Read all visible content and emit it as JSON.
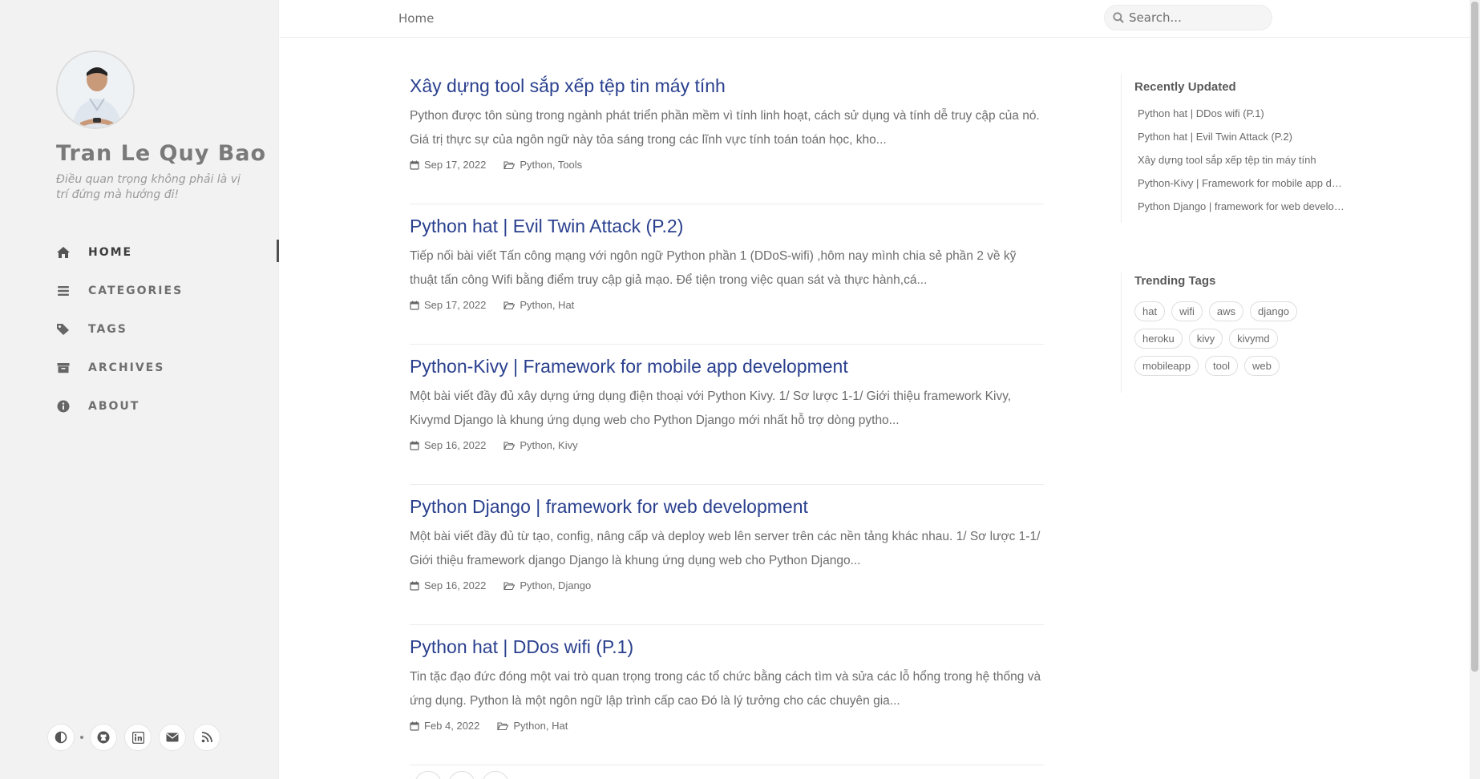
{
  "sidebar": {
    "site_title": "Tran Le Quy Bao",
    "site_subtitle": "Điều quan trọng không phải là vị trí đứng mà hướng đi!",
    "nav": [
      {
        "label": "HOME",
        "icon": "home-icon"
      },
      {
        "label": "CATEGORIES",
        "icon": "stream-icon"
      },
      {
        "label": "TAGS",
        "icon": "tag-icon"
      },
      {
        "label": "ARCHIVES",
        "icon": "archive-icon"
      },
      {
        "label": "ABOUT",
        "icon": "info-circle-icon"
      }
    ],
    "bottom_icons": [
      "theme-toggle-icon",
      "github-icon",
      "linkedin-icon",
      "email-icon",
      "rss-icon"
    ]
  },
  "topbar": {
    "breadcrumb": "Home",
    "search_placeholder": "Search..."
  },
  "posts": [
    {
      "title": "Xây dựng tool sắp xếp tệp tin máy tính",
      "excerpt": "Python được tôn sùng trong ngành phát triển phần mềm vì tính linh hoạt, cách sử dụng và tính dễ truy cập của nó. Giá trị thực sự của ngôn ngữ này tỏa sáng trong các lĩnh vực tính toán toán học, kho...",
      "date": "Sep 17, 2022",
      "categories": "Python, Tools"
    },
    {
      "title": "Python hat | Evil Twin Attack (P.2)",
      "excerpt": "Tiếp nối bài viết Tấn công mạng với ngôn ngữ Python phần 1 (DDoS-wifi) ,hôm nay mình chia sẻ phần 2 về kỹ thuật tấn công Wifi bằng điểm truy cập giả mạo. Để tiện trong việc quan sát và thực hành,cá...",
      "date": "Sep 17, 2022",
      "categories": "Python, Hat"
    },
    {
      "title": "Python-Kivy | Framework for mobile app development",
      "excerpt": "Một bài viết đầy đủ xây dựng ứng dụng điện thoại với Python Kivy. 1/ Sơ lược 1-1/ Giới thiệu framework Kivy, Kivymd Django là khung ứng dụng web cho Python Django mới nhất hỗ trợ dòng pytho...",
      "date": "Sep 16, 2022",
      "categories": "Python, Kivy"
    },
    {
      "title": "Python Django | framework for web development",
      "excerpt": "Một bài viết đầy đủ từ tạo, config, nâng cấp và deploy web lên server trên các nền tảng khác nhau. 1/ Sơ lược 1-1/ Giới thiệu framework django Django là khung ứng dụng web cho Python Django...",
      "date": "Sep 16, 2022",
      "categories": "Python, Django"
    },
    {
      "title": "Python hat | DDos wifi (P.1)",
      "excerpt": "Tin tặc đạo đức đóng một vai trò quan trọng trong các tổ chức bằng cách tìm và sửa các lỗ hổng trong hệ thống và ứng dụng. Python là một ngôn ngữ lập trình cấp cao Đó là lý tưởng cho các chuyên gia...",
      "date": "Feb 4, 2022",
      "categories": "Python, Hat"
    }
  ],
  "panel": {
    "recent_heading": "Recently Updated",
    "recent": [
      "Python hat | DDos wifi (P.1)",
      "Python hat | Evil Twin Attack (P.2)",
      "Xây dựng tool sắp xếp tệp tin máy tính",
      "Python-Kivy | Framework for mobile app development",
      "Python Django | framework for web development"
    ],
    "tags_heading": "Trending Tags",
    "tags": [
      "hat",
      "wifi",
      "aws",
      "django",
      "heroku",
      "kivy",
      "kivymd",
      "mobileapp",
      "tool",
      "web"
    ]
  }
}
